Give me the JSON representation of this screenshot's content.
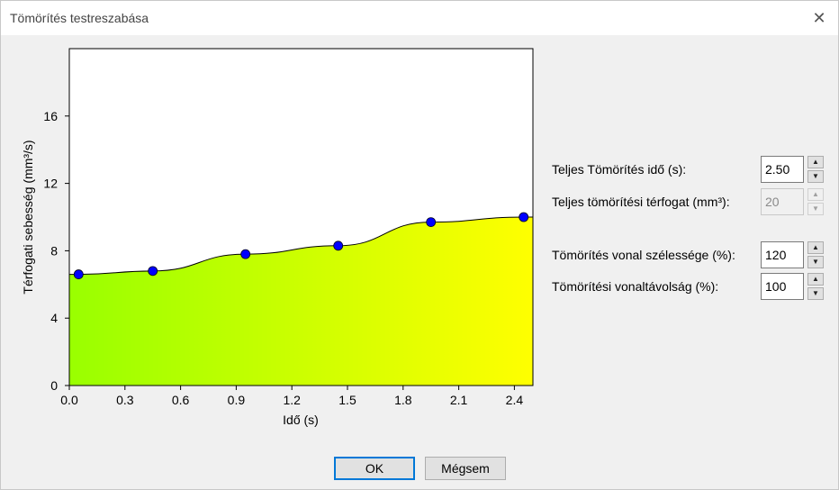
{
  "window": {
    "title": "Tömörítés testreszabása",
    "close_glyph": "✕"
  },
  "chart_data": {
    "type": "area",
    "xlabel": "Idő (s)",
    "ylabel": "Térfogati sebesség (mm³/s)",
    "xlim": [
      0.0,
      2.5
    ],
    "ylim": [
      0,
      20
    ],
    "x_ticks": [
      "0.0",
      "0.3",
      "0.6",
      "0.9",
      "1.2",
      "1.5",
      "1.8",
      "2.1",
      "2.4"
    ],
    "x_tick_values": [
      0.0,
      0.3,
      0.6,
      0.9,
      1.2,
      1.5,
      1.8,
      2.1,
      2.4
    ],
    "y_ticks": [
      "0",
      "4",
      "8",
      "12",
      "16"
    ],
    "y_tick_values": [
      0,
      4,
      8,
      12,
      16
    ],
    "points": [
      {
        "x": 0.05,
        "y": 6.6
      },
      {
        "x": 0.45,
        "y": 6.8
      },
      {
        "x": 0.95,
        "y": 7.8
      },
      {
        "x": 1.45,
        "y": 8.3
      },
      {
        "x": 1.95,
        "y": 9.7
      },
      {
        "x": 2.45,
        "y": 10.0
      }
    ],
    "fill_gradient": [
      "#99ff00",
      "#ffff00"
    ],
    "point_color": "#0000ff",
    "grid": false
  },
  "settings": {
    "total_time": {
      "label": "Teljes Tömörítés idő (s):",
      "value": "2.50"
    },
    "total_volume": {
      "label": "Teljes tömörítési térfogat (mm³):",
      "value": "20"
    },
    "line_width": {
      "label": "Tömörítés vonal szélessége (%):",
      "value": "120"
    },
    "line_spacing": {
      "label": "Tömörítési vonaltávolság (%):",
      "value": "100"
    }
  },
  "spin_glyphs": {
    "up": "▲",
    "down": "▼"
  },
  "buttons": {
    "ok": "OK",
    "cancel": "Mégsem"
  }
}
